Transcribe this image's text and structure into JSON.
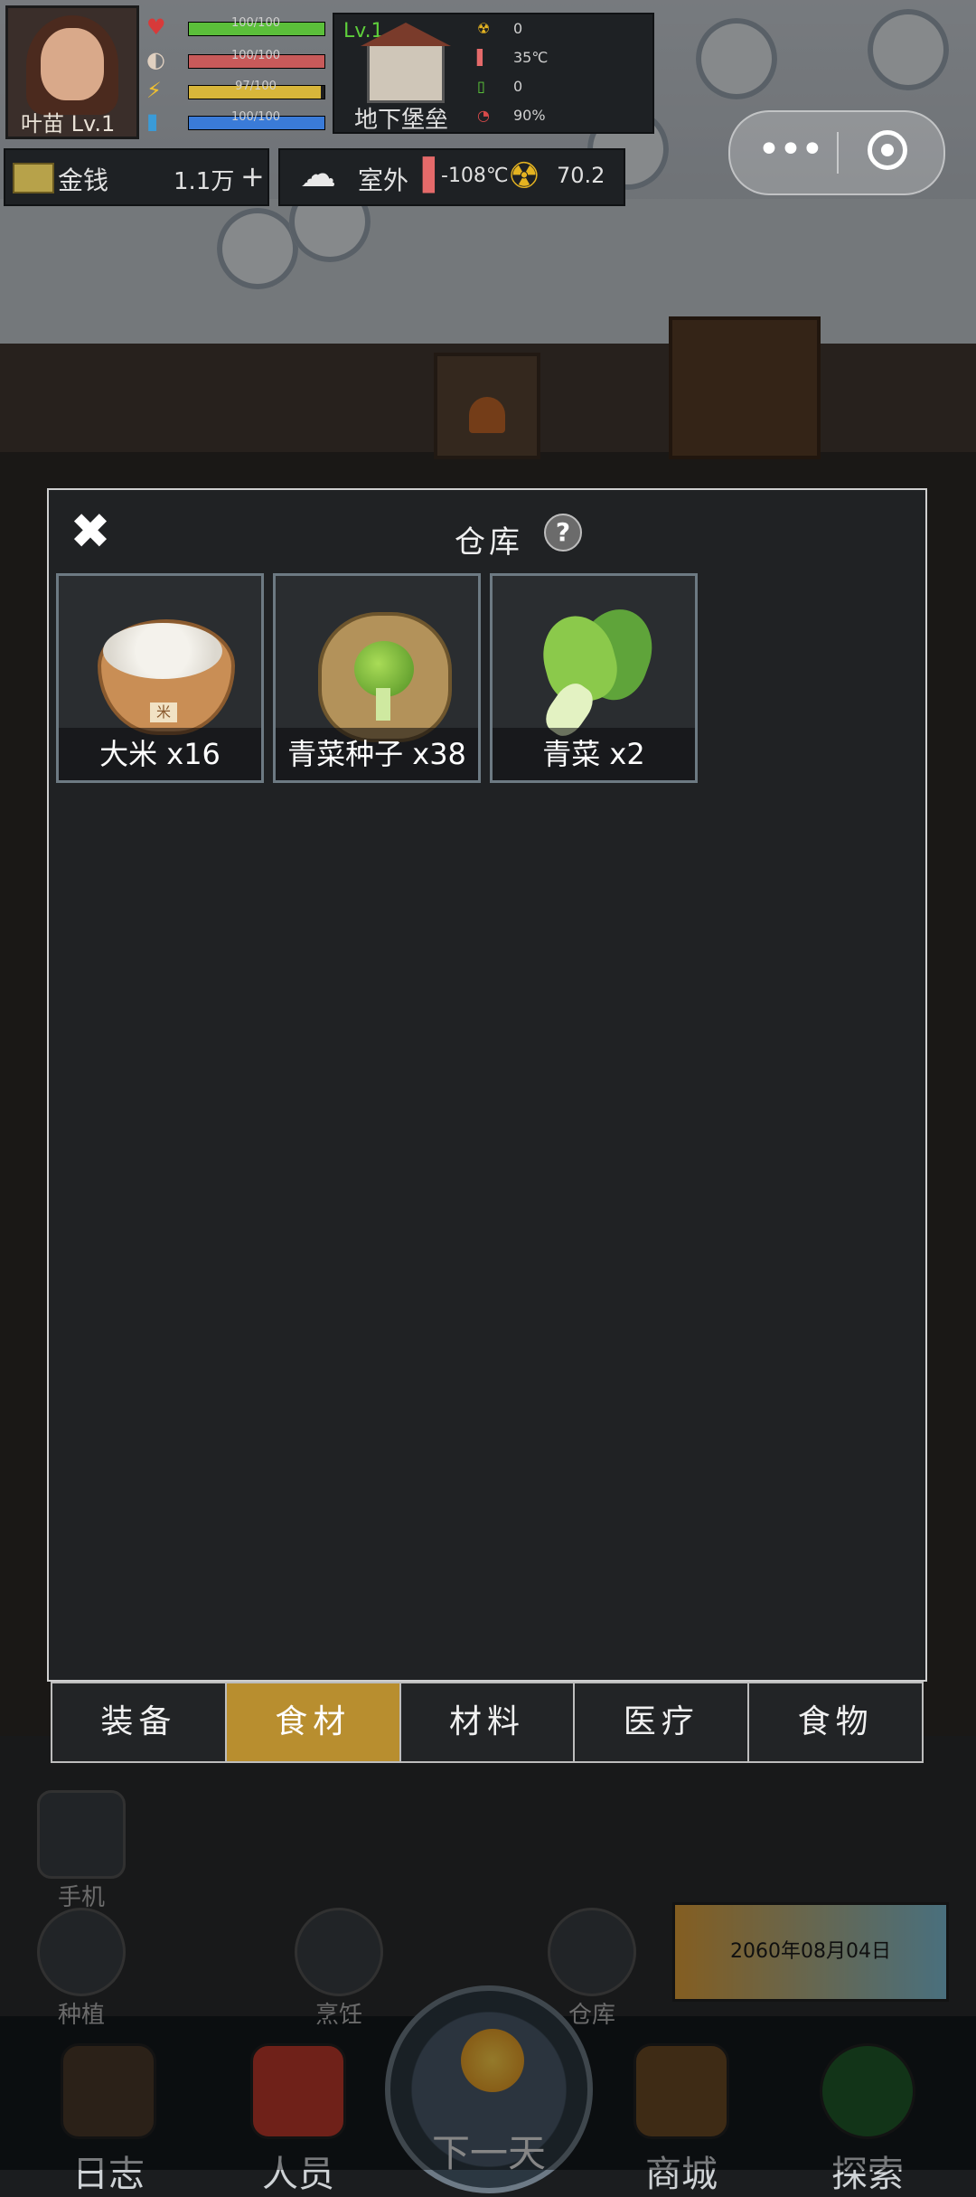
{
  "player": {
    "name": "叶苗",
    "level": "Lv.1"
  },
  "stats": [
    {
      "icon": "heart-icon",
      "glyph": "♥",
      "text": "100/100",
      "fill": 1.0,
      "color": "#5bbf3a"
    },
    {
      "icon": "stomach-icon",
      "glyph": "◐",
      "text": "100/100",
      "fill": 1.0,
      "color": "#c85a5a"
    },
    {
      "icon": "energy-icon",
      "glyph": "⚡",
      "text": "97/100",
      "fill": 0.97,
      "color": "#d8b63a"
    },
    {
      "icon": "water-icon",
      "glyph": "▮",
      "text": "100/100",
      "fill": 1.0,
      "color": "#3a7bd8"
    }
  ],
  "base": {
    "level": "Lv.1",
    "name": "地下堡垒",
    "stats": [
      {
        "icon": "radiation-icon",
        "glyph": "☢",
        "value": "0"
      },
      {
        "icon": "temperature-icon",
        "glyph": "🌡",
        "value": "35℃"
      },
      {
        "icon": "battery-icon",
        "glyph": "▯",
        "value": "0"
      },
      {
        "icon": "pie-icon",
        "glyph": "◔",
        "value": "90%"
      }
    ]
  },
  "money": {
    "label": "金钱",
    "value": "1.1万",
    "plus": "+"
  },
  "environment": {
    "label": "室外",
    "temp": "-108℃",
    "radiation": "70.2"
  },
  "capsule": {
    "dots": "•••"
  },
  "warehouse": {
    "title": "仓库",
    "help": "?",
    "close": "✖",
    "items": [
      {
        "label": "大米 x16",
        "icon": "rice-basket-icon",
        "tag": "米"
      },
      {
        "label": "青菜种子 x38",
        "icon": "seed-bag-icon"
      },
      {
        "label": "青菜 x2",
        "icon": "bok-choy-icon"
      }
    ],
    "tabs": [
      "装备",
      "食材",
      "材料",
      "医疗",
      "食物"
    ],
    "active_tab": 1
  },
  "shortcuts": [
    {
      "label": "手机",
      "icon": "phone-icon"
    },
    {
      "label": "种植",
      "icon": "sprout-icon"
    },
    {
      "label": "烹饪",
      "icon": "cooking-pot-icon"
    },
    {
      "label": "仓库",
      "icon": "crate-icon"
    }
  ],
  "date": "2060年08月04日",
  "nav": [
    {
      "label": "日志",
      "icon": "journal-icon"
    },
    {
      "label": "人员",
      "icon": "id-card-icon"
    },
    {
      "label": "下一天",
      "icon": "sun-icon"
    },
    {
      "label": "商城",
      "icon": "basket-icon"
    },
    {
      "label": "探索",
      "icon": "radar-icon"
    }
  ]
}
